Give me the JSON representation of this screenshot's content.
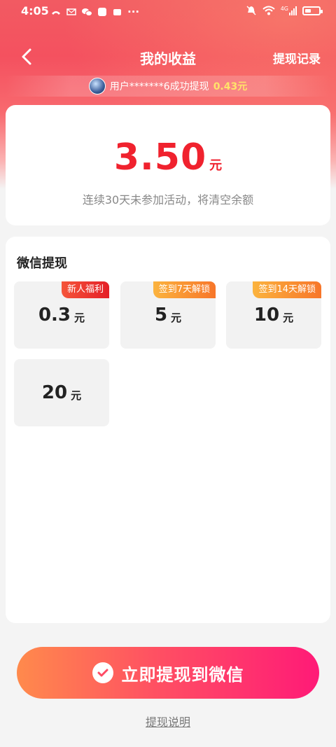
{
  "status": {
    "time": "4:05",
    "network": "4G"
  },
  "nav": {
    "title": "我的收益",
    "record_label": "提现记录"
  },
  "ticker": {
    "text": "用户*******6成功提现",
    "amount": "0.43元"
  },
  "balance": {
    "value": "3.50",
    "unit": "元",
    "note": "连续30天未参加活动，将清空余额"
  },
  "withdraw": {
    "title": "微信提现",
    "options": [
      {
        "value": "0.3",
        "unit": "元",
        "tag": "新人福利"
      },
      {
        "value": "5",
        "unit": "元",
        "tag": "签到7天解锁"
      },
      {
        "value": "10",
        "unit": "元",
        "tag": "签到14天解锁"
      },
      {
        "value": "20",
        "unit": "元",
        "tag": ""
      }
    ]
  },
  "cta": {
    "label": "立即提现到微信"
  },
  "help": {
    "label": "提现说明"
  },
  "colors": {
    "accent": "#f0222e",
    "tag_red": "#e41f27",
    "tag_orange": "#f7762a"
  }
}
